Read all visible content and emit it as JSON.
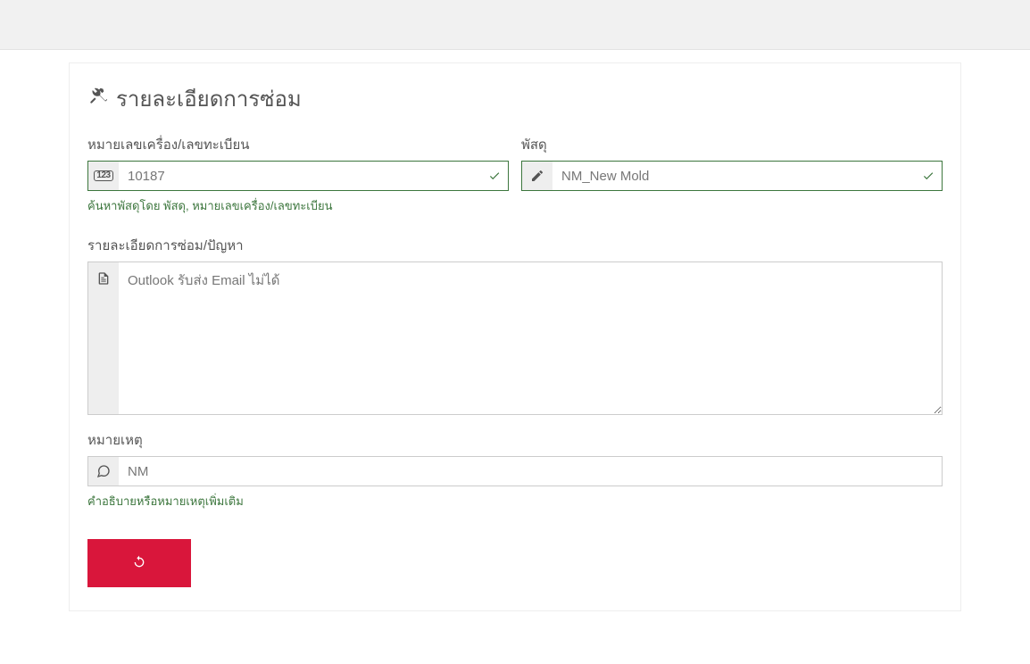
{
  "title": "รายละเอียดการซ่อม",
  "fields": {
    "machine": {
      "label": "หมายเลขเครื่อง/เลขทะเบียน",
      "value": "10187",
      "help": "ค้นหาพัสดุโดย พัสดุ, หมายเลขเครื่อง/เลขทะเบียน"
    },
    "material": {
      "label": "พัสดุ",
      "value": "NM_New Mold"
    },
    "problem": {
      "label": "รายละเอียดการซ่อม/ปัญหา",
      "value": "Outlook รับส่ง Email ไม่ได้"
    },
    "note": {
      "label": "หมายเหตุ",
      "value": "NM",
      "help": "คำอธิบายหรือหมายเหตุเพิ่มเติม"
    }
  }
}
